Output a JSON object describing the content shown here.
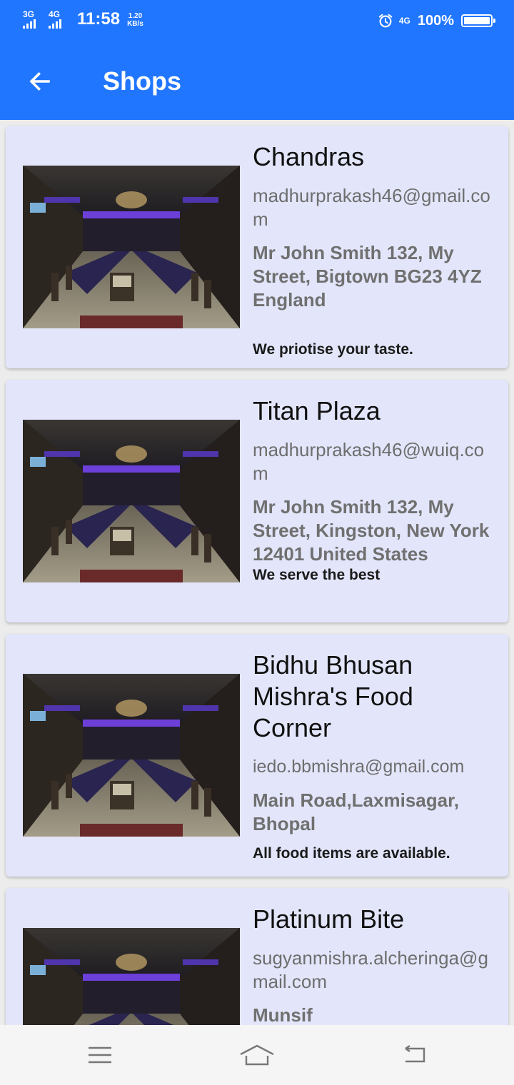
{
  "status_bar": {
    "net1": "3G",
    "net2": "4G",
    "time": "11:58",
    "speed_value": "1.20",
    "speed_unit": "KB/s",
    "net3": "4G",
    "battery": "100%",
    "battery_level": 1.0
  },
  "app_bar": {
    "title": "Shops",
    "back_icon": "arrow-left-icon"
  },
  "shops": [
    {
      "name": "Chandras",
      "email": "madhurprakash46@gmail.com",
      "address": "Mr John Smith 132, My Street, Bigtown BG23 4YZ England",
      "tagline": "We priotise your taste."
    },
    {
      "name": "Titan Plaza",
      "email": "madhurprakash46@wuiq.com",
      "address": "Mr John Smith 132, My Street, Kingston, New York 12401 United States",
      "tagline": "We serve the best"
    },
    {
      "name": "Bidhu Bhusan Mishra's Food Corner",
      "email": "iedo.bbmishra@gmail.com",
      "address": "Main Road,Laxmisagar, Bhopal",
      "tagline": "All food items are available."
    },
    {
      "name": "Platinum Bite",
      "email": "sugyanmishra.alcheringa@gmail.com",
      "address": "Munsif",
      "tagline": ""
    }
  ],
  "nav_bar": {
    "menu_icon": "menu-icon",
    "home_icon": "home-icon",
    "back_icon": "back-icon"
  },
  "colors": {
    "primary": "#2176ff",
    "card_bg": "#e3e6fa",
    "page_bg": "#ececec"
  }
}
